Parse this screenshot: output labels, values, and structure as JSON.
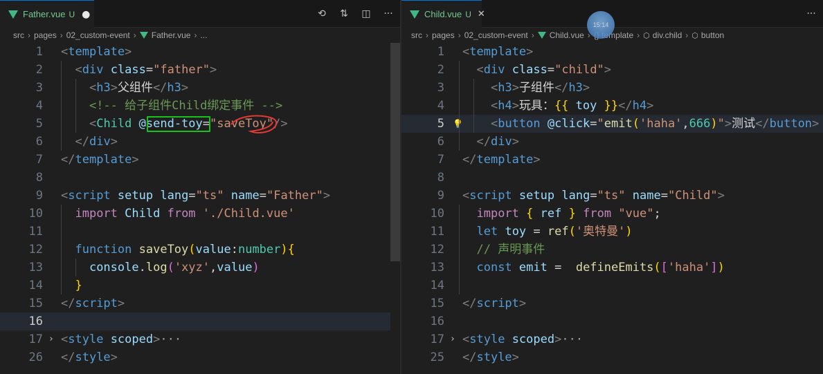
{
  "left": {
    "tab": {
      "filename": "Father.vue",
      "status": "U",
      "modified_dot": "●"
    },
    "toolbar": {
      "history_icon": "⟲",
      "compare_icon": "⇅",
      "split_icon": "◫",
      "more_icon": "···"
    },
    "breadcrumb": [
      "src",
      "pages",
      "02_custom-event",
      "Father.vue",
      "..."
    ],
    "line_numbers": [
      "1",
      "2",
      "3",
      "4",
      "5",
      "6",
      "7",
      "8",
      "9",
      "10",
      "11",
      "12",
      "13",
      "14",
      "15",
      "16",
      "17",
      "26"
    ],
    "lines": [
      [
        [
          "t-br",
          "<"
        ],
        [
          "t-tag",
          "template"
        ],
        [
          "t-br",
          ">"
        ]
      ],
      [
        [
          "t-txt",
          "  "
        ],
        [
          "t-br",
          "<"
        ],
        [
          "t-tag",
          "div"
        ],
        [
          "t-txt",
          " "
        ],
        [
          "t-attr",
          "class"
        ],
        [
          "t-txt",
          "="
        ],
        [
          "t-str",
          "\"father\""
        ],
        [
          "t-br",
          ">"
        ]
      ],
      [
        [
          "t-txt",
          "    "
        ],
        [
          "t-br",
          "<"
        ],
        [
          "t-tag",
          "h3"
        ],
        [
          "t-br",
          ">"
        ],
        [
          "t-txt",
          "父组件"
        ],
        [
          "t-br",
          "</"
        ],
        [
          "t-tag",
          "h3"
        ],
        [
          "t-br",
          ">"
        ]
      ],
      [
        [
          "t-txt",
          "    "
        ],
        [
          "t-cmt",
          "<!-- 给子组件Child绑定事件 -->"
        ]
      ],
      [
        [
          "t-txt",
          "    "
        ],
        [
          "t-br",
          "<"
        ],
        [
          "t-def",
          "Child"
        ],
        [
          "t-txt",
          " "
        ],
        [
          "t-attr",
          "@send-toy"
        ],
        [
          "t-txt",
          "="
        ],
        [
          "t-str",
          "\"saveToy\""
        ],
        [
          "t-br",
          "/>"
        ]
      ],
      [
        [
          "t-txt",
          "  "
        ],
        [
          "t-br",
          "</"
        ],
        [
          "t-tag",
          "div"
        ],
        [
          "t-br",
          ">"
        ]
      ],
      [
        [
          "t-br",
          "</"
        ],
        [
          "t-tag",
          "template"
        ],
        [
          "t-br",
          ">"
        ]
      ],
      [],
      [
        [
          "t-br",
          "<"
        ],
        [
          "t-tag",
          "script"
        ],
        [
          "t-txt",
          " "
        ],
        [
          "t-attr",
          "setup"
        ],
        [
          "t-txt",
          " "
        ],
        [
          "t-attr",
          "lang"
        ],
        [
          "t-txt",
          "="
        ],
        [
          "t-str",
          "\"ts\""
        ],
        [
          "t-txt",
          " "
        ],
        [
          "t-attr",
          "name"
        ],
        [
          "t-txt",
          "="
        ],
        [
          "t-str",
          "\"Father\""
        ],
        [
          "t-br",
          ">"
        ]
      ],
      [
        [
          "t-txt",
          "  "
        ],
        [
          "t-kw",
          "import"
        ],
        [
          "t-txt",
          " "
        ],
        [
          "t-var",
          "Child"
        ],
        [
          "t-txt",
          " "
        ],
        [
          "t-kw",
          "from"
        ],
        [
          "t-txt",
          " "
        ],
        [
          "t-str",
          "'./Child.vue'"
        ]
      ],
      [],
      [
        [
          "t-txt",
          "  "
        ],
        [
          "t-kw2",
          "function"
        ],
        [
          "t-txt",
          " "
        ],
        [
          "t-fn",
          "saveToy"
        ],
        [
          "t-p1",
          "("
        ],
        [
          "t-var",
          "value"
        ],
        [
          "t-txt",
          ":"
        ],
        [
          "t-def",
          "number"
        ],
        [
          "t-p1",
          ")"
        ],
        [
          "t-p1",
          "{"
        ]
      ],
      [
        [
          "t-txt",
          "    "
        ],
        [
          "t-var",
          "console"
        ],
        [
          "t-txt",
          "."
        ],
        [
          "t-fn",
          "log"
        ],
        [
          "t-p2",
          "("
        ],
        [
          "t-str",
          "'xyz'"
        ],
        [
          "t-txt",
          ","
        ],
        [
          "t-var",
          "value"
        ],
        [
          "t-p2",
          ")"
        ]
      ],
      [
        [
          "t-txt",
          "  "
        ],
        [
          "t-p1",
          "}"
        ]
      ],
      [
        [
          "t-br",
          "</"
        ],
        [
          "t-tag",
          "script"
        ],
        [
          "t-br",
          ">"
        ]
      ],
      [],
      [
        [
          "t-br",
          "<"
        ],
        [
          "t-tag",
          "style"
        ],
        [
          "t-txt",
          " "
        ],
        [
          "t-attr",
          "scoped"
        ],
        [
          "t-br",
          ">"
        ],
        [
          "t-ell",
          "···"
        ]
      ],
      [
        [
          "t-br",
          "</"
        ],
        [
          "t-tag",
          "style"
        ],
        [
          "t-br",
          ">"
        ]
      ]
    ]
  },
  "right": {
    "tab": {
      "filename": "Child.vue",
      "status": "U",
      "close_icon": "✕"
    },
    "toolbar": {
      "more_icon": "···"
    },
    "avatar_text": "15:14",
    "breadcrumb": [
      "src",
      "pages",
      "02_custom-event",
      "Child.vue",
      "{} template",
      "div.child",
      "button"
    ],
    "line_numbers": [
      "1",
      "2",
      "3",
      "4",
      "5",
      "6",
      "7",
      "8",
      "9",
      "10",
      "11",
      "12",
      "13",
      "14",
      "15",
      "16",
      "17",
      "25"
    ],
    "lines": [
      [
        [
          "t-br",
          "<"
        ],
        [
          "t-tag",
          "template"
        ],
        [
          "t-br",
          ">"
        ]
      ],
      [
        [
          "t-txt",
          "  "
        ],
        [
          "t-br",
          "<"
        ],
        [
          "t-tag",
          "div"
        ],
        [
          "t-txt",
          " "
        ],
        [
          "t-attr",
          "class"
        ],
        [
          "t-txt",
          "="
        ],
        [
          "t-str",
          "\"child\""
        ],
        [
          "t-br",
          ">"
        ]
      ],
      [
        [
          "t-txt",
          "    "
        ],
        [
          "t-br",
          "<"
        ],
        [
          "t-tag",
          "h3"
        ],
        [
          "t-br",
          ">"
        ],
        [
          "t-txt",
          "子组件"
        ],
        [
          "t-br",
          "</"
        ],
        [
          "t-tag",
          "h3"
        ],
        [
          "t-br",
          ">"
        ]
      ],
      [
        [
          "t-txt",
          "    "
        ],
        [
          "t-br",
          "<"
        ],
        [
          "t-tag",
          "h4"
        ],
        [
          "t-br",
          ">"
        ],
        [
          "t-txt",
          "玩具："
        ],
        [
          "t-p1",
          "{{"
        ],
        [
          "t-txt",
          " "
        ],
        [
          "t-var",
          "toy"
        ],
        [
          "t-txt",
          " "
        ],
        [
          "t-p1",
          "}}"
        ],
        [
          "t-br",
          "</"
        ],
        [
          "t-tag",
          "h4"
        ],
        [
          "t-br",
          ">"
        ]
      ],
      [
        [
          "t-txt",
          "    "
        ],
        [
          "t-br",
          "<"
        ],
        [
          "t-tag",
          "button"
        ],
        [
          "t-txt",
          " "
        ],
        [
          "t-attr",
          "@click"
        ],
        [
          "t-txt",
          "="
        ],
        [
          "t-str",
          "\""
        ],
        [
          "t-fn",
          "emit"
        ],
        [
          "t-p1",
          "("
        ],
        [
          "t-str",
          "'haha'"
        ],
        [
          "t-txt",
          ","
        ],
        [
          "t-def",
          "666"
        ],
        [
          "t-p1",
          ")"
        ],
        [
          "t-str",
          "\""
        ],
        [
          "t-br",
          ">"
        ],
        [
          "t-txt",
          "测试"
        ],
        [
          "t-br",
          "</"
        ],
        [
          "t-tag",
          "button"
        ],
        [
          "t-br",
          ">"
        ]
      ],
      [
        [
          "t-txt",
          "  "
        ],
        [
          "t-br",
          "</"
        ],
        [
          "t-tag",
          "div"
        ],
        [
          "t-br",
          ">"
        ]
      ],
      [
        [
          "t-br",
          "</"
        ],
        [
          "t-tag",
          "template"
        ],
        [
          "t-br",
          ">"
        ]
      ],
      [],
      [
        [
          "t-br",
          "<"
        ],
        [
          "t-tag",
          "script"
        ],
        [
          "t-txt",
          " "
        ],
        [
          "t-attr",
          "setup"
        ],
        [
          "t-txt",
          " "
        ],
        [
          "t-attr",
          "lang"
        ],
        [
          "t-txt",
          "="
        ],
        [
          "t-str",
          "\"ts\""
        ],
        [
          "t-txt",
          " "
        ],
        [
          "t-attr",
          "name"
        ],
        [
          "t-txt",
          "="
        ],
        [
          "t-str",
          "\"Child\""
        ],
        [
          "t-br",
          ">"
        ]
      ],
      [
        [
          "t-txt",
          "  "
        ],
        [
          "t-kw",
          "import"
        ],
        [
          "t-txt",
          " "
        ],
        [
          "t-p1",
          "{"
        ],
        [
          "t-txt",
          " "
        ],
        [
          "t-var",
          "ref"
        ],
        [
          "t-txt",
          " "
        ],
        [
          "t-p1",
          "}"
        ],
        [
          "t-txt",
          " "
        ],
        [
          "t-kw",
          "from"
        ],
        [
          "t-txt",
          " "
        ],
        [
          "t-str",
          "\"vue\""
        ],
        [
          "t-txt",
          ";"
        ]
      ],
      [
        [
          "t-txt",
          "  "
        ],
        [
          "t-kw2",
          "let"
        ],
        [
          "t-txt",
          " "
        ],
        [
          "t-var",
          "toy"
        ],
        [
          "t-txt",
          " = "
        ],
        [
          "t-fn",
          "ref"
        ],
        [
          "t-p1",
          "("
        ],
        [
          "t-str",
          "'奥特曼'"
        ],
        [
          "t-p1",
          ")"
        ]
      ],
      [
        [
          "t-txt",
          "  "
        ],
        [
          "t-cmt",
          "// 声明事件"
        ]
      ],
      [
        [
          "t-txt",
          "  "
        ],
        [
          "t-kw2",
          "const"
        ],
        [
          "t-txt",
          " "
        ],
        [
          "t-var",
          "emit"
        ],
        [
          "t-txt",
          " =  "
        ],
        [
          "t-fn",
          "defineEmits"
        ],
        [
          "t-p1",
          "("
        ],
        [
          "t-p2",
          "["
        ],
        [
          "t-str",
          "'haha'"
        ],
        [
          "t-p2",
          "]"
        ],
        [
          "t-p1",
          ")"
        ]
      ],
      [],
      [
        [
          "t-br",
          "</"
        ],
        [
          "t-tag",
          "script"
        ],
        [
          "t-br",
          ">"
        ]
      ],
      [],
      [
        [
          "t-br",
          "<"
        ],
        [
          "t-tag",
          "style"
        ],
        [
          "t-txt",
          " "
        ],
        [
          "t-attr",
          "scoped"
        ],
        [
          "t-br",
          ">"
        ],
        [
          "t-ell",
          "···"
        ]
      ],
      [
        [
          "t-br",
          "</"
        ],
        [
          "t-tag",
          "style"
        ],
        [
          "t-br",
          ">"
        ]
      ]
    ]
  }
}
